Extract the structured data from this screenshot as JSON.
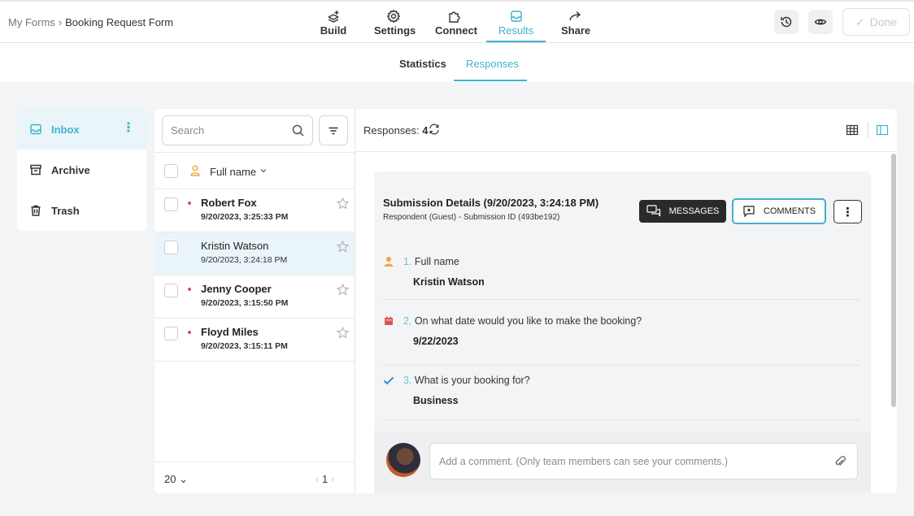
{
  "breadcrumb": {
    "parent": "My Forms",
    "separator": "›",
    "current": "Booking Request Form"
  },
  "nav": {
    "tabs": [
      {
        "label": "Build",
        "icon": "build-icon"
      },
      {
        "label": "Settings",
        "icon": "gear-icon"
      },
      {
        "label": "Connect",
        "icon": "puzzle-icon"
      },
      {
        "label": "Results",
        "icon": "inbox-icon",
        "active": true
      },
      {
        "label": "Share",
        "icon": "share-arrow-icon"
      }
    ],
    "history_icon": "history-icon",
    "preview_icon": "eye-icon",
    "done_label": "Done",
    "done_check": "✓"
  },
  "subtabs": {
    "statistics": "Statistics",
    "responses": "Responses"
  },
  "folders": [
    {
      "label": "Inbox",
      "icon": "inbox-icon",
      "active": true,
      "menu": "⋮"
    },
    {
      "label": "Archive",
      "icon": "archive-icon"
    },
    {
      "label": "Trash",
      "icon": "trash-icon"
    }
  ],
  "list": {
    "search_placeholder": "Search",
    "column_label": "Full name",
    "items": [
      {
        "name": "Robert Fox",
        "date": "9/20/2023, 3:25:33 PM",
        "unread": true,
        "selected": false
      },
      {
        "name": "Kristin Watson",
        "date": "9/20/2023, 3:24:18 PM",
        "unread": false,
        "selected": true
      },
      {
        "name": "Jenny Cooper",
        "date": "9/20/2023, 3:15:50 PM",
        "unread": true,
        "selected": false
      },
      {
        "name": "Floyd Miles",
        "date": "9/20/2023, 3:15:11 PM",
        "unread": true,
        "selected": false
      }
    ],
    "per_page": "20",
    "page": "1",
    "page_prev": "‹",
    "page_next": "›"
  },
  "detail": {
    "responses_label": "Responses:",
    "responses_count": "4",
    "title": "Submission Details (9/20/2023, 3:24:18 PM)",
    "meta": "Respondent (Guest) - Submission ID (493be192)",
    "messages_label": "MESSAGES",
    "comments_label": "COMMENTS",
    "more_label": "⋮",
    "answers": [
      {
        "num": "1.",
        "question": "Full name",
        "answer": "Kristin Watson",
        "icon": "person-icon",
        "icon_color": "#f0a742"
      },
      {
        "num": "2.",
        "question": "On what date would you like to make the booking?",
        "answer": "9/22/2023",
        "icon": "calendar-icon",
        "icon_color": "#d9534f"
      },
      {
        "num": "3.",
        "question": "What is your booking for?",
        "answer": "Business",
        "icon": "check-icon",
        "icon_color": "#3a8ee6"
      }
    ],
    "comment_placeholder": "Add a comment. (Only team members can see your comments.)"
  },
  "colors": {
    "accent": "#3fb2cf",
    "unread_dot": "#d9534f"
  }
}
